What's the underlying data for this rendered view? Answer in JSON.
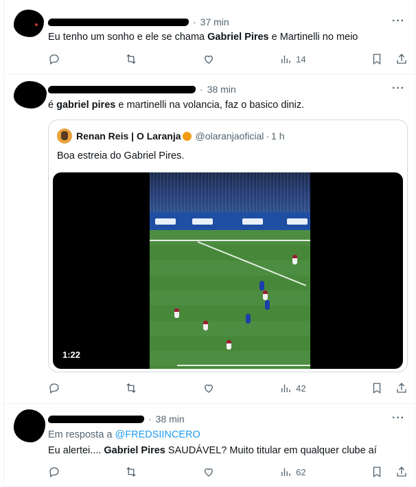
{
  "tweets": [
    {
      "time": "37 min",
      "more": "···",
      "text_pre": "Eu tenho um sonho e ele se chama ",
      "text_bold": "Gabriel Pires",
      "text_post": " e Martinelli no meio",
      "views": "14"
    },
    {
      "time": "38 min",
      "more": "···",
      "text_pre": "é ",
      "text_bold": "gabriel pires",
      "text_post": " e martinelli na volancia, faz o basico diniz.",
      "views": "42",
      "quote": {
        "name": "Renan Reis | O Laranja",
        "handle": "@olaranjaoficial",
        "time": "1 h",
        "text": "Boa estreia do Gabriel Pires.",
        "video_duration": "1:22"
      }
    },
    {
      "time": "38 min",
      "more": "···",
      "reply_prefix": "Em resposta a ",
      "reply_to": "@FREDSIINCERO",
      "text_pre": "Eu alertei.... ",
      "text_bold": "Gabriel Pires",
      "text_post": " SAUDÁVEL? Muito titular em qualquer clube aí",
      "views": "62"
    }
  ],
  "separator": "·",
  "icons": [
    "reply-icon",
    "retweet-icon",
    "like-icon",
    "views-icon",
    "bookmark-icon",
    "share-icon",
    "more-icon"
  ],
  "colors": {
    "link": "#1d9bf0",
    "muted": "#536471",
    "text": "#0f1419",
    "border": "#eff3f4"
  }
}
